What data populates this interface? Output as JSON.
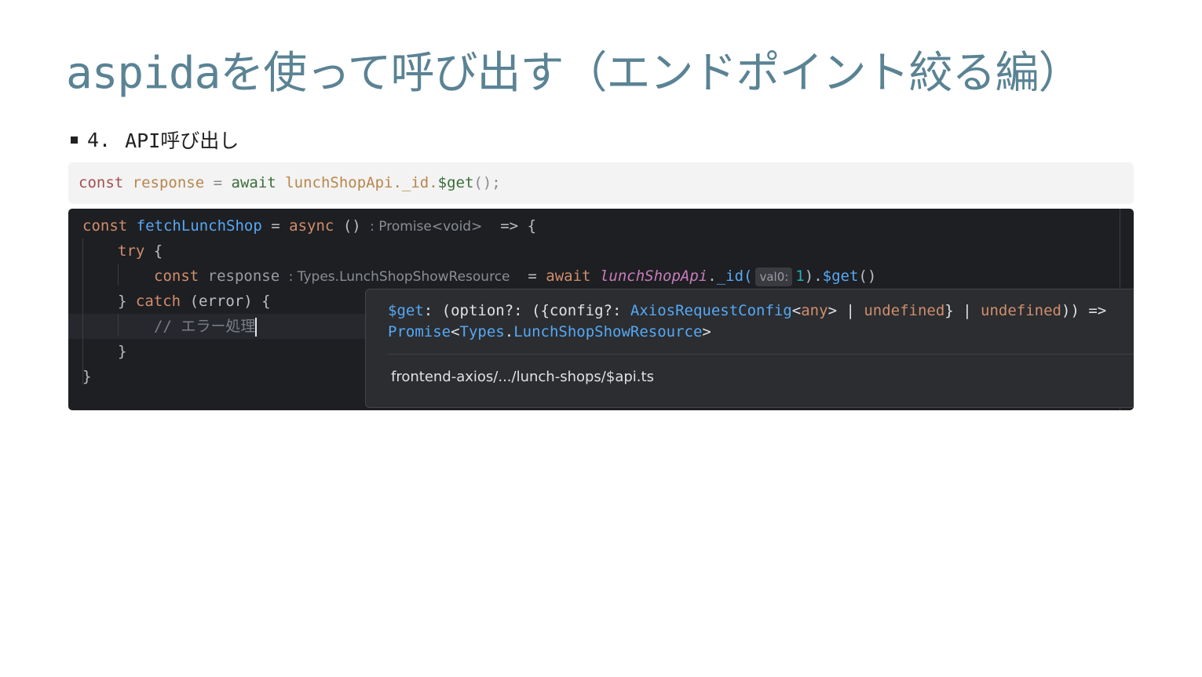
{
  "slide": {
    "title": "aspidaを使って呼び出す（エンドポイント絞る編）",
    "bullet_number": "4.",
    "bullet_text": "API呼び出し"
  },
  "codeblock": {
    "kw_const": "const",
    "var_response": "response",
    "op_eq": "=",
    "kw_await": "await",
    "expr": "lunchShopApi._id.",
    "method": "$get",
    "tail": "();"
  },
  "ide": {
    "line1": {
      "kw_const": "const",
      "fn_name": "fetchLunchShop",
      "op_eq": "=",
      "kw_async": "async",
      "parens": "()",
      "type_hint": ": Promise<void>",
      "arrow": "=>",
      "brace": "{"
    },
    "line2": {
      "kw_try": "try",
      "brace": "{"
    },
    "line3": {
      "kw_const": "const",
      "var_response": "response",
      "type_hint": ": Types.LunchShopShowResource",
      "op_eq": "=",
      "kw_await": "await",
      "obj": "lunchShopApi",
      "dot": ".",
      "call": "_id(",
      "param_hint": "val0:",
      "num": "1",
      "close": ").",
      "method": "$get",
      "tail": "()"
    },
    "line4": {
      "close_brace": "}",
      "kw_catch": "catch",
      "args": "(error) {"
    },
    "line5": {
      "comment": "// エラー処理"
    },
    "line6": {
      "brace": "}"
    },
    "line7": {
      "brace": "}"
    }
  },
  "popup": {
    "sig_fn": "$get",
    "sig_a": ": (option?: ({config?: ",
    "sig_type1": "AxiosRequestConfig",
    "sig_b": "<",
    "sig_any": "any",
    "sig_c": "> | ",
    "sig_undef1": "undefined",
    "sig_d": "} | ",
    "sig_undef2": "undefined",
    "sig_e": ")) =>",
    "sig_promise": "Promise",
    "sig_f": "<",
    "sig_types": "Types",
    "sig_g": ".",
    "sig_resource": "LunchShopShowResource",
    "sig_h": ">",
    "path": "frontend-axios/.../lunch-shops/$api.ts"
  },
  "colors": {
    "title": "#5a8394",
    "ide_bg": "#1e1f22",
    "popup_bg": "#2b2d30",
    "keyword": "#cf8e6d",
    "function": "#56a8f5"
  }
}
